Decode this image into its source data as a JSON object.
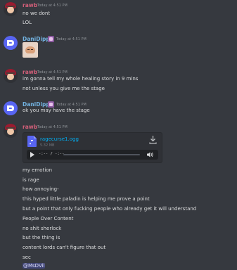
{
  "messages": {
    "g1": {
      "author": "rawb",
      "timestamp": "Today at 4:51 PM",
      "lines": [
        "no we dont",
        "LOL"
      ]
    },
    "g2": {
      "author": "DaniDipp",
      "timestamp": "Today at 4:51 PM",
      "sticker": "emote-sticker"
    },
    "g3": {
      "author": "rawb",
      "timestamp": "Today at 4:51 PM",
      "lines": [
        "im gonna tell my whole healing story in 9 mins",
        "not unless you give me the stage"
      ]
    },
    "g4": {
      "author": "DaniDipp",
      "timestamp": "Today at 4:51 PM",
      "lines": [
        "ok you may have the stage"
      ]
    },
    "g5": {
      "author": "rawb",
      "timestamp": "Today at 4:51 PM",
      "attachment": {
        "filename": "ragecurse1.ogg",
        "size": "5.32 MB",
        "time": "-:-- / -:--"
      },
      "lines": [
        "my emotion",
        "is rage",
        "how annoying-",
        "this hyped little paladin is helping me prove a point",
        "but a point that only fucking people who already get it will understand",
        "People Over Content",
        "no shit sherlock",
        "but the thing is",
        "content lords can't figure that out",
        "sec"
      ],
      "mention": "@MsDVil"
    }
  },
  "colors": {
    "background": "#36393f",
    "rawb_name": "#d35f79",
    "dani_name": "#72b2e0",
    "link": "#00aff4",
    "text": "#dcddde"
  }
}
